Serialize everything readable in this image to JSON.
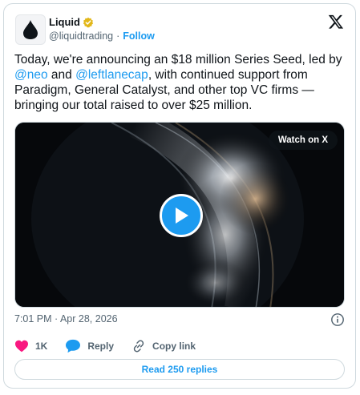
{
  "author": {
    "name": "Liquid",
    "handle": "@liquidtrading",
    "separator": "·",
    "follow_label": "Follow",
    "verified": true
  },
  "tweet": {
    "text_parts": {
      "p1": "Today, we're announcing an $18 million Series Seed, led by ",
      "mention1": "@neo",
      "p2": " and ",
      "mention2": "@leftlanecap",
      "p3": ", with continued support from Paradigm, General Catalyst, and other top VC firms — bringing our total raised to over $25 million."
    },
    "timestamp": "7:01 PM · Apr 28, 2026"
  },
  "media": {
    "watch_label": "Watch on X",
    "type": "video"
  },
  "actions": {
    "like_count": "1K",
    "reply_label": "Reply",
    "copy_link_label": "Copy link",
    "read_replies_label": "Read 250 replies"
  },
  "colors": {
    "accent": "#1d9bf0",
    "like": "#f91880",
    "verified_gold": "#e2b719",
    "text": "#0f1419",
    "muted": "#536471"
  },
  "icons": [
    "drop-logo-icon",
    "verified-badge-icon",
    "x-logo-icon",
    "play-icon",
    "info-icon",
    "heart-icon",
    "reply-bubble-icon",
    "link-icon"
  ]
}
